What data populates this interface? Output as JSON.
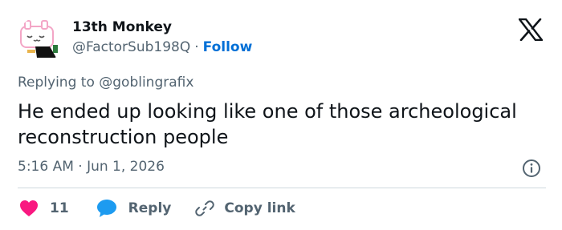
{
  "author": {
    "display_name": "13th Monkey",
    "handle": "@FactorSub198Q",
    "separator": "·",
    "follow_label": "Follow",
    "avatar_icon": "cartoon-character-avatar"
  },
  "brand_icon": "x-logo-icon",
  "reply": {
    "prefix": "Replying to",
    "mention": "@goblingrafix"
  },
  "tweet": {
    "text": "He ended up looking like one of those archeological reconstruction people",
    "timestamp": "5:16 AM · Jun 1, 2026"
  },
  "actions": {
    "like_count": "11",
    "reply_label": "Reply",
    "copy_label": "Copy link"
  },
  "colors": {
    "text": "#0f1419",
    "secondary": "#536471",
    "link": "#006fd6",
    "like": "#f91880",
    "reply": "#1d9bf0",
    "divider": "#cfd9de"
  }
}
